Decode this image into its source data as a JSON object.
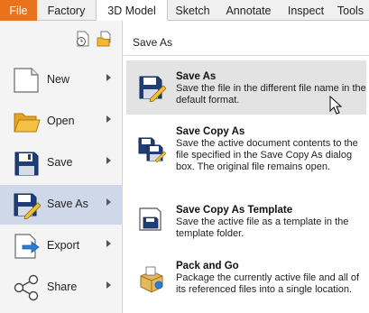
{
  "ribbon": {
    "tabs": [
      {
        "label": "File"
      },
      {
        "label": "Factory"
      },
      {
        "label": "3D Model"
      },
      {
        "label": "Sketch"
      },
      {
        "label": "Annotate"
      },
      {
        "label": "Inspect"
      },
      {
        "label": "Tools"
      }
    ],
    "active_tab": "3D Model"
  },
  "menu": {
    "items": [
      {
        "label": "New",
        "icon": "new-document-icon"
      },
      {
        "label": "Open",
        "icon": "open-folder-icon"
      },
      {
        "label": "Save",
        "icon": "save-disk-icon"
      },
      {
        "label": "Save As",
        "icon": "save-as-icon",
        "selected": true
      },
      {
        "label": "Export",
        "icon": "export-icon"
      },
      {
        "label": "Share",
        "icon": "share-icon"
      }
    ]
  },
  "submenu": {
    "title": "Save As",
    "options": [
      {
        "title": "Save As",
        "description": "Save the file in the different file name in the default format.",
        "icon": "save-as-icon"
      },
      {
        "title": "Save Copy As",
        "description": "Save the active document contents to the file specified in the Save Copy As dialog box. The original file remains open.",
        "icon": "save-copy-as-icon"
      },
      {
        "title": "Save Copy As Template",
        "description": "Save the active file as a template in the template folder.",
        "icon": "save-template-icon"
      },
      {
        "title": "Pack and Go",
        "description": "Package the currently active file and all of its referenced files into a single location.",
        "icon": "pack-and-go-icon"
      }
    ]
  },
  "colors": {
    "file_tab": "#e8731c",
    "selected_item": "#cfd8e8",
    "highlight": "#e3e3e3",
    "floppy": "#1f3e78"
  }
}
